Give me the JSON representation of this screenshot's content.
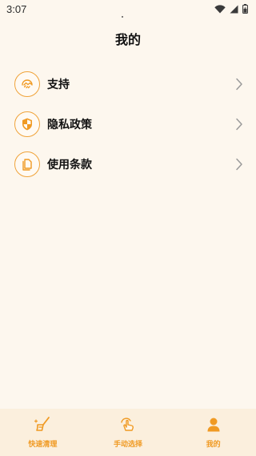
{
  "status_bar": {
    "time": "3:07",
    "icons": [
      "wifi-icon",
      "signal-icon",
      "battery-icon"
    ]
  },
  "header": {
    "title": "我的"
  },
  "menu": {
    "items": [
      {
        "label": "支持",
        "icon": "handshake-icon"
      },
      {
        "label": "隐私政策",
        "icon": "shield-icon"
      },
      {
        "label": "使用条款",
        "icon": "document-icon"
      }
    ]
  },
  "bottom_nav": {
    "tabs": [
      {
        "label": "快速清理",
        "icon": "broom-icon"
      },
      {
        "label": "手动选择",
        "icon": "tap-hand-icon"
      },
      {
        "label": "我的",
        "icon": "person-icon",
        "active": true
      }
    ]
  },
  "colors": {
    "accent": "#f09a23",
    "background": "#fdf7ee",
    "nav_background": "#fbefdd"
  }
}
